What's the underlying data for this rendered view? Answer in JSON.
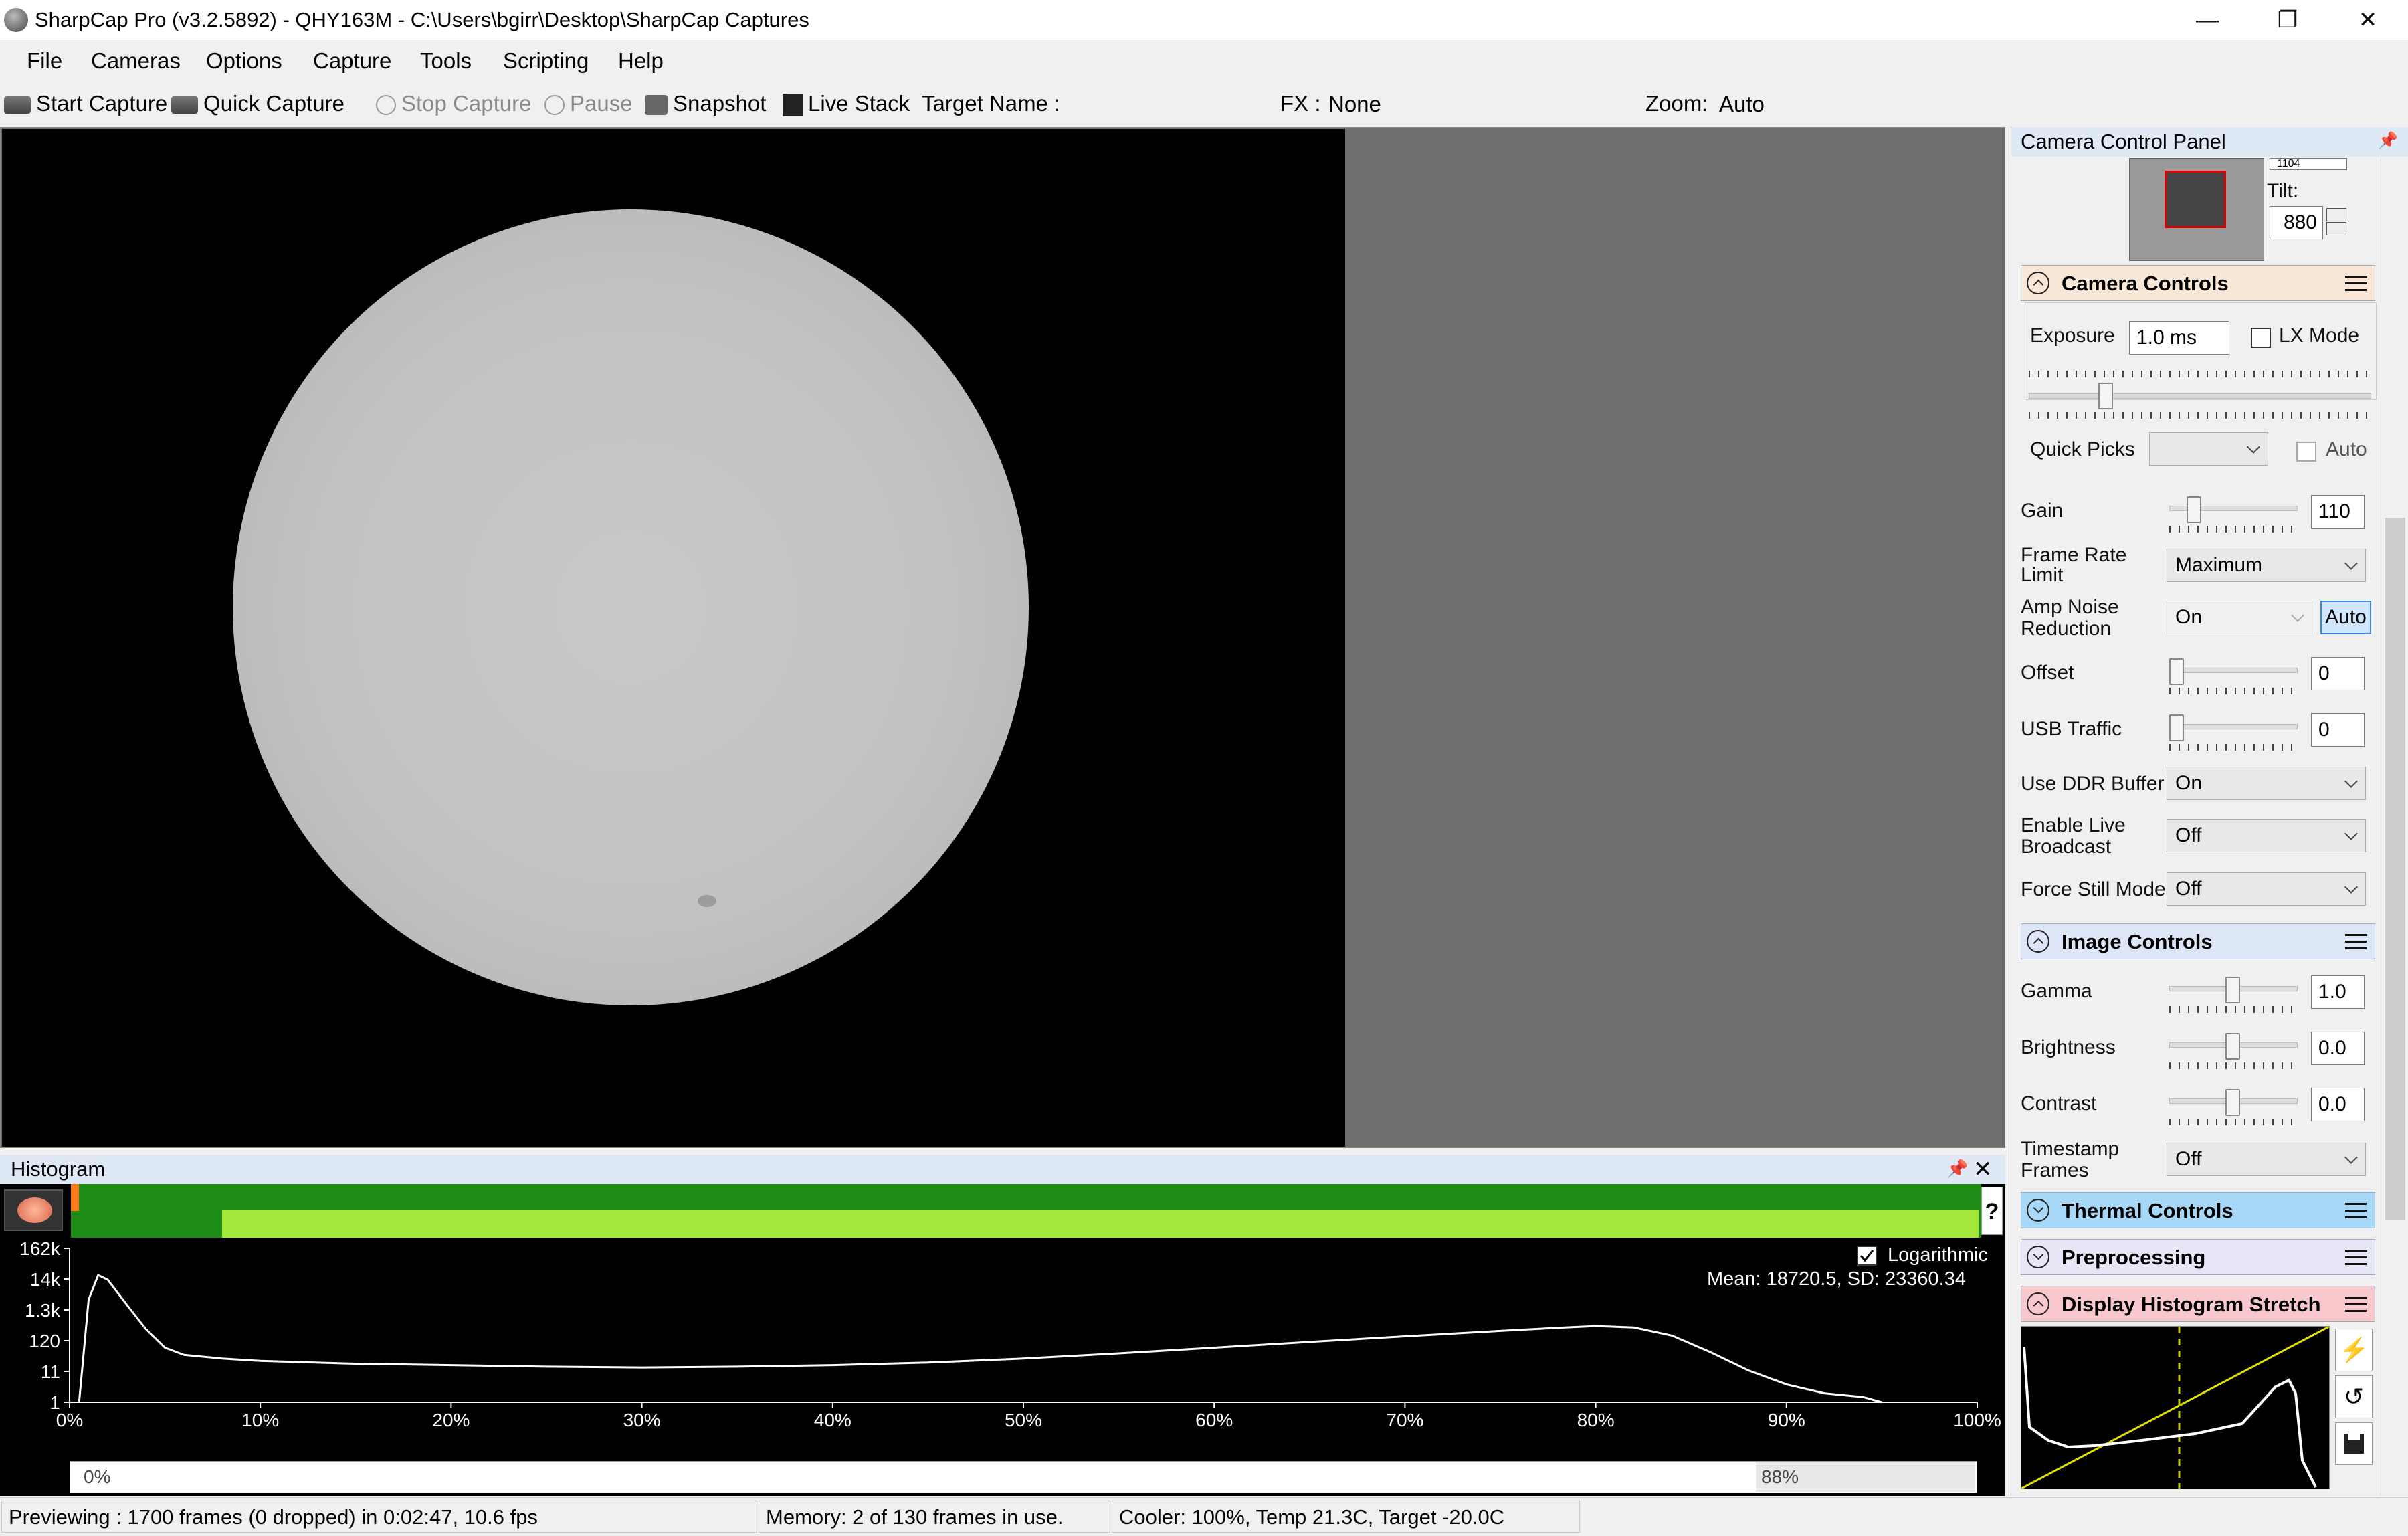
{
  "window": {
    "title": "SharpCap Pro (v3.2.5892) - QHY163M - C:\\Users\\bgirr\\Desktop\\SharpCap Captures",
    "minimize_glyph": "—",
    "maximize_glyph": "❐",
    "close_glyph": "✕"
  },
  "menu": [
    "File",
    "Cameras",
    "Options",
    "Capture",
    "Tools",
    "Scripting",
    "Help"
  ],
  "toolbar": {
    "start_capture": "Start Capture",
    "quick_capture": "Quick Capture",
    "stop_capture": "Stop Capture",
    "pause": "Pause",
    "snapshot": "Snapshot",
    "live_stack": "Live Stack",
    "target_name_label": "Target Name :",
    "target_name_value": "",
    "fx_label": "FX :",
    "fx_value": "None",
    "zoom_label": "Zoom:",
    "zoom_value": "Auto"
  },
  "histogram": {
    "title": "Histogram",
    "logarithmic_label": "Logarithmic",
    "logarithmic_checked": true,
    "stats": "Mean: 18720.5, SD: 23360.34",
    "y_ticks": [
      "162k",
      "14k",
      "1.3k",
      "120",
      "11",
      "1"
    ],
    "x_ticks": [
      "0%",
      "10%",
      "20%",
      "30%",
      "40%",
      "50%",
      "60%",
      "70%",
      "80%",
      "90%",
      "100%"
    ],
    "range_low": "0%",
    "range_high": "88%",
    "help": "?"
  },
  "chart_data": {
    "type": "line",
    "title": "",
    "xlabel": "",
    "ylabel": "",
    "x_unit": "%",
    "log_scale_y": true,
    "xlim": [
      0,
      100
    ],
    "ylim": [
      1,
      162000
    ],
    "series": [
      {
        "x": [
          0.5,
          1,
          1.5,
          2,
          3,
          4,
          5,
          6,
          8,
          10,
          15,
          20,
          25,
          30,
          35,
          40,
          45,
          50,
          55,
          60,
          65,
          70,
          75,
          78,
          80,
          82,
          84,
          86,
          88,
          90,
          92,
          94,
          95
        ],
        "y": [
          1,
          3000,
          20000,
          14000,
          2000,
          300,
          70,
          40,
          30,
          25,
          20,
          18,
          16,
          15,
          16,
          18,
          22,
          30,
          45,
          70,
          110,
          170,
          260,
          330,
          380,
          340,
          180,
          50,
          12,
          4,
          2,
          1.5,
          1
        ]
      }
    ]
  },
  "status": {
    "preview": "Previewing : 1700 frames (0 dropped) in 0:02:47, 10.6 fps",
    "memory": "Memory: 2 of 130 frames in use.",
    "cooler": "Cooler: 100%, Temp 21.3C, Target -20.0C"
  },
  "panel": {
    "title": "Camera Control Panel",
    "pin_glyph": "📌",
    "tilt_label": "Tilt:",
    "tilt_value": "880",
    "top_value": "1104",
    "camera_controls": {
      "title": "Camera Controls",
      "exposure_label": "Exposure",
      "exposure_value": "1.0 ms",
      "lx_mode_label": "LX Mode",
      "quick_picks_label": "Quick Picks",
      "quick_picks_value": "",
      "auto_label": "Auto",
      "gain_label": "Gain",
      "gain_value": "110",
      "frame_rate_label_1": "Frame Rate",
      "frame_rate_label_2": "Limit",
      "frame_rate_value": "Maximum",
      "amp_noise_label_1": "Amp Noise",
      "amp_noise_label_2": "Reduction",
      "amp_noise_value": "On",
      "amp_noise_auto": "Auto",
      "offset_label": "Offset",
      "offset_value": "0",
      "usb_label": "USB Traffic",
      "usb_value": "0",
      "ddr_label": "Use DDR Buffer",
      "ddr_value": "On",
      "broadcast_label_1": "Enable Live",
      "broadcast_label_2": "Broadcast",
      "broadcast_value": "Off",
      "force_still_label": "Force Still Mode",
      "force_still_value": "Off"
    },
    "image_controls": {
      "title": "Image Controls",
      "gamma_label": "Gamma",
      "gamma_value": "1.0",
      "brightness_label": "Brightness",
      "brightness_value": "0.0",
      "contrast_label": "Contrast",
      "contrast_value": "0.0",
      "timestamp_label_1": "Timestamp",
      "timestamp_label_2": "Frames",
      "timestamp_value": "Off"
    },
    "thermal_controls": {
      "title": "Thermal Controls"
    },
    "preprocessing": {
      "title": "Preprocessing"
    },
    "display_stretch": {
      "title": "Display Histogram Stretch"
    }
  },
  "colors": {
    "histogram_bar_dark": "#1c8c14",
    "histogram_bar_light": "#a3e83b",
    "thermal_header": "#a8d8f8",
    "preprocessing_header": "#e6e6f6",
    "stretch_header": "#f8c8cc",
    "camera_header": "#f8e6d6",
    "image_header": "#dce6f6"
  }
}
